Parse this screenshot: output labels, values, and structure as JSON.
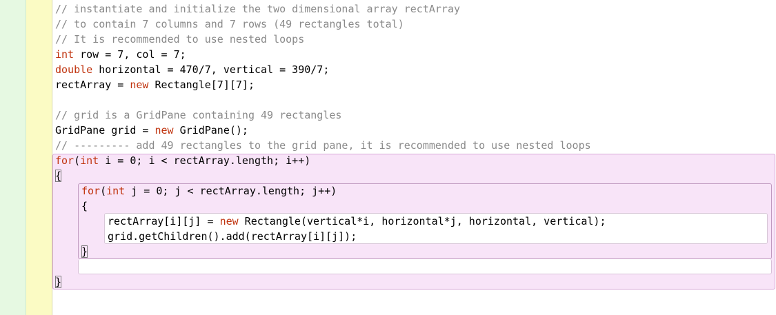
{
  "lines": [
    {
      "id": "c1",
      "segments": [
        {
          "text": "// instantiate and initialize the two dimensional array rectArray",
          "cls": "cm"
        }
      ]
    },
    {
      "id": "c2",
      "segments": [
        {
          "text": "// to contain 7 columns and 7 rows (49 rectangles total)",
          "cls": "cm"
        }
      ]
    },
    {
      "id": "c3",
      "segments": [
        {
          "text": "// It is recommended to use nested loops",
          "cls": "cm"
        }
      ]
    },
    {
      "id": "l4",
      "segments": [
        {
          "text": "int",
          "cls": "kw"
        },
        {
          "text": " row = 7, col = 7;",
          "cls": ""
        }
      ]
    },
    {
      "id": "l5",
      "segments": [
        {
          "text": "double",
          "cls": "kw"
        },
        {
          "text": " horizontal = 470/7, vertical = 390/7;",
          "cls": ""
        }
      ]
    },
    {
      "id": "l6",
      "segments": [
        {
          "text": "rectArray = ",
          "cls": ""
        },
        {
          "text": "new",
          "cls": "kw"
        },
        {
          "text": " Rectangle[7][7];",
          "cls": ""
        }
      ]
    },
    {
      "id": "l8",
      "segments": [
        {
          "text": "// grid is a GridPane containing 49 rectangles",
          "cls": "cm"
        }
      ]
    },
    {
      "id": "l9",
      "segments": [
        {
          "text": "GridPane grid = ",
          "cls": ""
        },
        {
          "text": "new",
          "cls": "kw"
        },
        {
          "text": " GridPane();",
          "cls": ""
        }
      ]
    },
    {
      "id": "l10",
      "segments": [
        {
          "text": "// --------- add 49 rectangles to the grid pane, it is recommended to use nested loops",
          "cls": "cm"
        }
      ]
    },
    {
      "id": "l11",
      "segments": [
        {
          "text": "for",
          "cls": "kw"
        },
        {
          "text": "(",
          "cls": ""
        },
        {
          "text": "int",
          "cls": "kw"
        },
        {
          "text": " i = 0; i < rectArray.length; i++)",
          "cls": ""
        }
      ]
    },
    {
      "id": "l12",
      "segments": [
        {
          "text": "{",
          "cls": "brace"
        }
      ]
    },
    {
      "id": "l13",
      "segments": [
        {
          "text": "for",
          "cls": "kw"
        },
        {
          "text": "(",
          "cls": ""
        },
        {
          "text": "int",
          "cls": "kw"
        },
        {
          "text": " j = 0; j < rectArray.length; j++)",
          "cls": ""
        }
      ]
    },
    {
      "id": "l14",
      "segments": [
        {
          "text": "{",
          "cls": ""
        }
      ]
    },
    {
      "id": "l15",
      "segments": [
        {
          "text": "rectArray[i][j] = ",
          "cls": ""
        },
        {
          "text": "new",
          "cls": "kw"
        },
        {
          "text": " Rectangle(vertical*i, horizontal*j, horizontal, vertical);",
          "cls": ""
        }
      ]
    },
    {
      "id": "l16",
      "segments": [
        {
          "text": "grid.getChildren().add(rectArray[i][j]);",
          "cls": ""
        }
      ]
    },
    {
      "id": "l17",
      "segments": [
        {
          "text": "}",
          "cls": "brace"
        }
      ]
    },
    {
      "id": "l19",
      "segments": [
        {
          "text": "}",
          "cls": "brace"
        }
      ]
    }
  ]
}
